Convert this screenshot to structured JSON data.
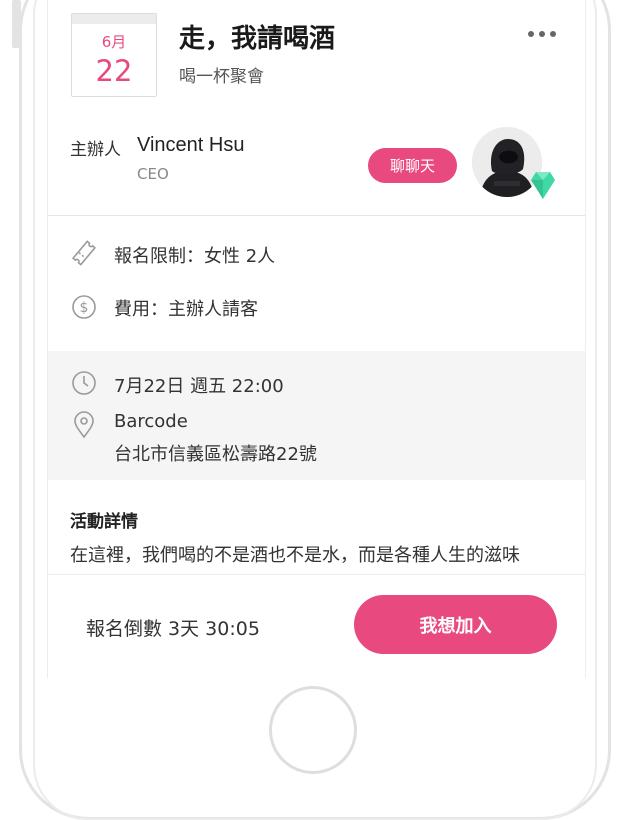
{
  "event": {
    "month": "6月",
    "day": "22",
    "title": "走，我請喝酒",
    "subtitle": "喝一杯聚會",
    "more_icon": "more-horizontal-icon"
  },
  "host": {
    "label": "主辦人",
    "name": "Vincent Hsu",
    "title": "CEO",
    "chat_button": "聊聊天",
    "avatar_badge_color": "#3fd9a4"
  },
  "info": {
    "limit": "報名限制：女性 2人",
    "fee": "費用：主辦人請客",
    "datetime": "7月22日 週五 22:00",
    "venue": "Barcode",
    "address": "台北市信義區松壽路22號"
  },
  "details": {
    "title": "活動詳情",
    "text": "在這裡，我們喝的不是酒也不是水，而是各種人生的滋味"
  },
  "footer": {
    "countdown": "報名倒數 3天 30:05",
    "join_button": "我想加入"
  },
  "colors": {
    "accent": "#e84a7f",
    "band": "#f5f5f5"
  }
}
